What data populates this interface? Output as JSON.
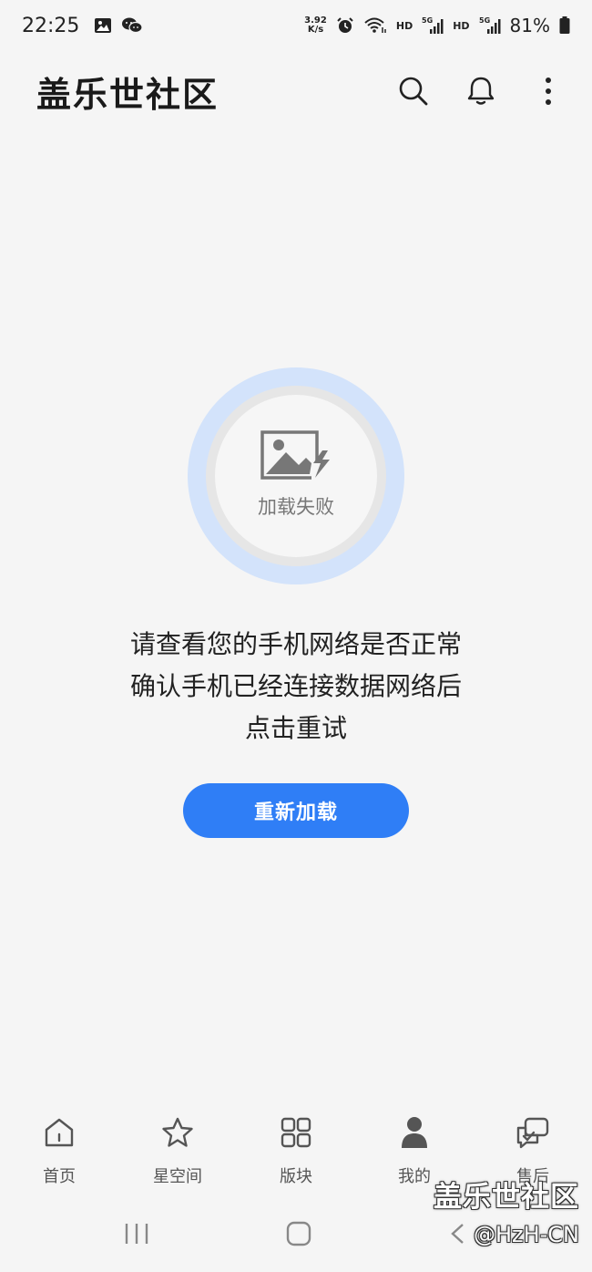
{
  "status_bar": {
    "time": "22:25",
    "net_speed_value": "3.92",
    "net_speed_unit": "K/s",
    "hd1": "HD",
    "sim1": "5G",
    "hd2": "HD",
    "sim2": "5G",
    "battery": "81%",
    "icons": [
      "gallery-icon",
      "wechat-icon",
      "alarm-icon",
      "wifi-icon",
      "signal-icon",
      "battery-icon"
    ]
  },
  "header": {
    "title": "盖乐世社区",
    "icons": [
      "search-icon",
      "bell-icon",
      "more-icon"
    ]
  },
  "error": {
    "icon": "broken-image-icon",
    "caption": "加载失败",
    "message_lines": [
      "请查看您的手机网络是否正常",
      "确认手机已经连接数据网络后",
      "点击重试"
    ],
    "reload_label": "重新加载"
  },
  "tabs": [
    {
      "label": "首页",
      "icon": "home-icon"
    },
    {
      "label": "星空间",
      "icon": "star-icon"
    },
    {
      "label": "版块",
      "icon": "grid-icon"
    },
    {
      "label": "我的",
      "icon": "user-icon"
    },
    {
      "label": "售后",
      "icon": "service-chat-icon"
    }
  ],
  "watermark": {
    "title": "盖乐世社区",
    "handle": "@HzH-CN"
  },
  "colors": {
    "accent": "#2f7ef6",
    "background": "#f5f5f5",
    "ring": "#d3e3fb"
  }
}
